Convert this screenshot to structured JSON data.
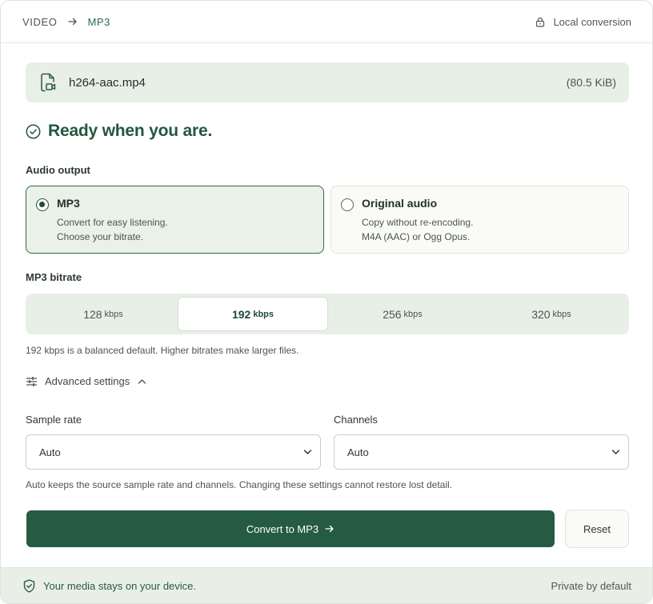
{
  "header": {
    "crumb_from": "VIDEO",
    "crumb_to": "MP3",
    "local_label": "Local conversion"
  },
  "file": {
    "name": "h264-aac.mp4",
    "size": "(80.5 KiB)"
  },
  "status": {
    "heading": "Ready when you are."
  },
  "audio_output": {
    "label": "Audio output",
    "options": [
      {
        "title": "MP3",
        "line1": "Convert for easy listening.",
        "line2": "Choose your bitrate.",
        "selected": true
      },
      {
        "title": "Original audio",
        "line1": "Copy without re-encoding.",
        "line2": "M4A (AAC) or Ogg Opus.",
        "selected": false
      }
    ]
  },
  "bitrate": {
    "label": "MP3 bitrate",
    "unit": "kbps",
    "options": [
      "128",
      "192",
      "256",
      "320"
    ],
    "selected": "192",
    "hint": "192 kbps is a balanced default. Higher bitrates make larger files."
  },
  "advanced": {
    "toggle_label": "Advanced settings",
    "expanded": true,
    "sample_rate": {
      "label": "Sample rate",
      "value": "Auto"
    },
    "channels": {
      "label": "Channels",
      "value": "Auto"
    },
    "hint": "Auto keeps the source sample rate and channels. Changing these settings cannot restore lost detail."
  },
  "actions": {
    "convert_label": "Convert to MP3",
    "reset_label": "Reset"
  },
  "footer": {
    "privacy_note": "Your media stays on your device.",
    "right_note": "Private by default"
  },
  "colors": {
    "accent": "#255b42",
    "accent_light": "#e8efe7",
    "heading": "#23573f"
  },
  "icons": {
    "crumb_separator": "arrow-right-icon",
    "local": "lock-icon",
    "file": "video-file-icon",
    "status": "check-circle-icon",
    "advanced": "sliders-icon",
    "advanced_toggle": "chevron-up-icon",
    "select": "chevron-down-icon",
    "convert": "arrow-right-icon",
    "footer": "shield-check-icon"
  }
}
